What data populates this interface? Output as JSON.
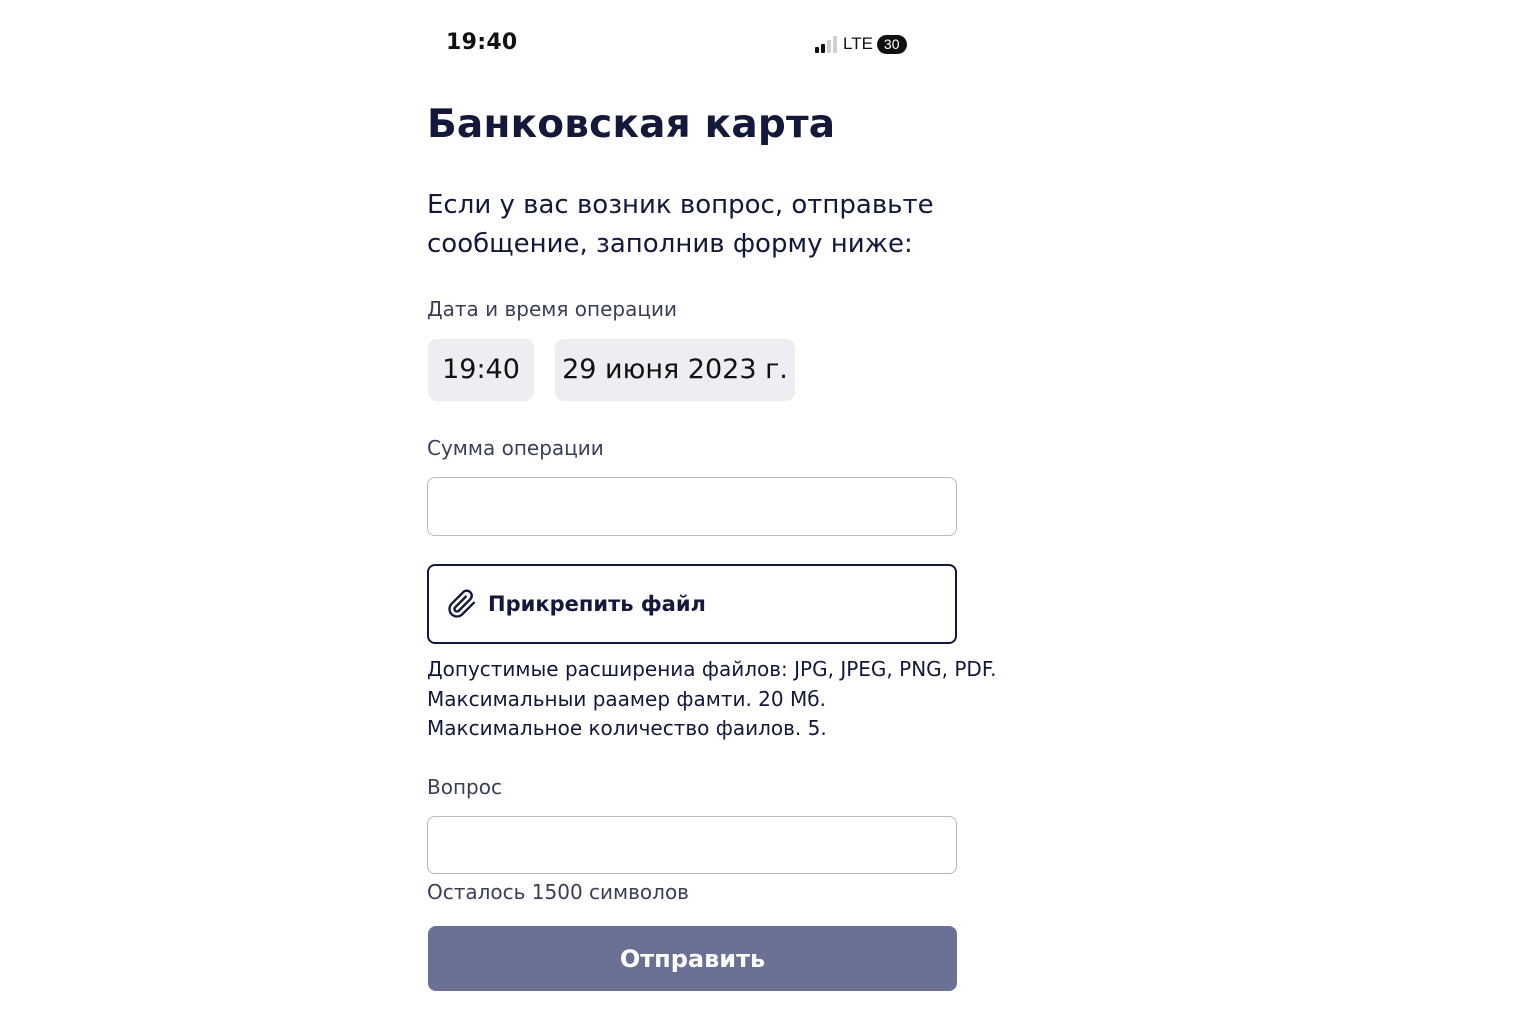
{
  "status_bar": {
    "time": "19:40",
    "network": "LTE",
    "battery": "30",
    "signal_bars_filled": 2,
    "signal_bars_total": 4
  },
  "page": {
    "title": "Банковская карта",
    "intro": "Если у вас возник вопрос, отправьте сообщение, заполнив форму ниже:"
  },
  "operation_datetime": {
    "label": "Дата и время операции",
    "time": "19:40",
    "date": "29 июня 2023 г."
  },
  "amount": {
    "label": "Сумма операции",
    "value": "",
    "placeholder": ""
  },
  "attach": {
    "icon": "paperclip-icon",
    "label": "Прикрепить файл"
  },
  "file_hints": {
    "line1": "Допустимые расширениа файлов: JPG, JPEG, PNG, PDF.",
    "line2": "Максимальныи раамер фамти. 20 Мб.",
    "line3": "Максимальное количество фаилов. 5."
  },
  "question": {
    "label": "Вопрос",
    "value": "",
    "placeholder": "",
    "remaining": "Осталось 1500 символов"
  },
  "submit": {
    "label": "Отправить",
    "color": "#6b7195"
  }
}
